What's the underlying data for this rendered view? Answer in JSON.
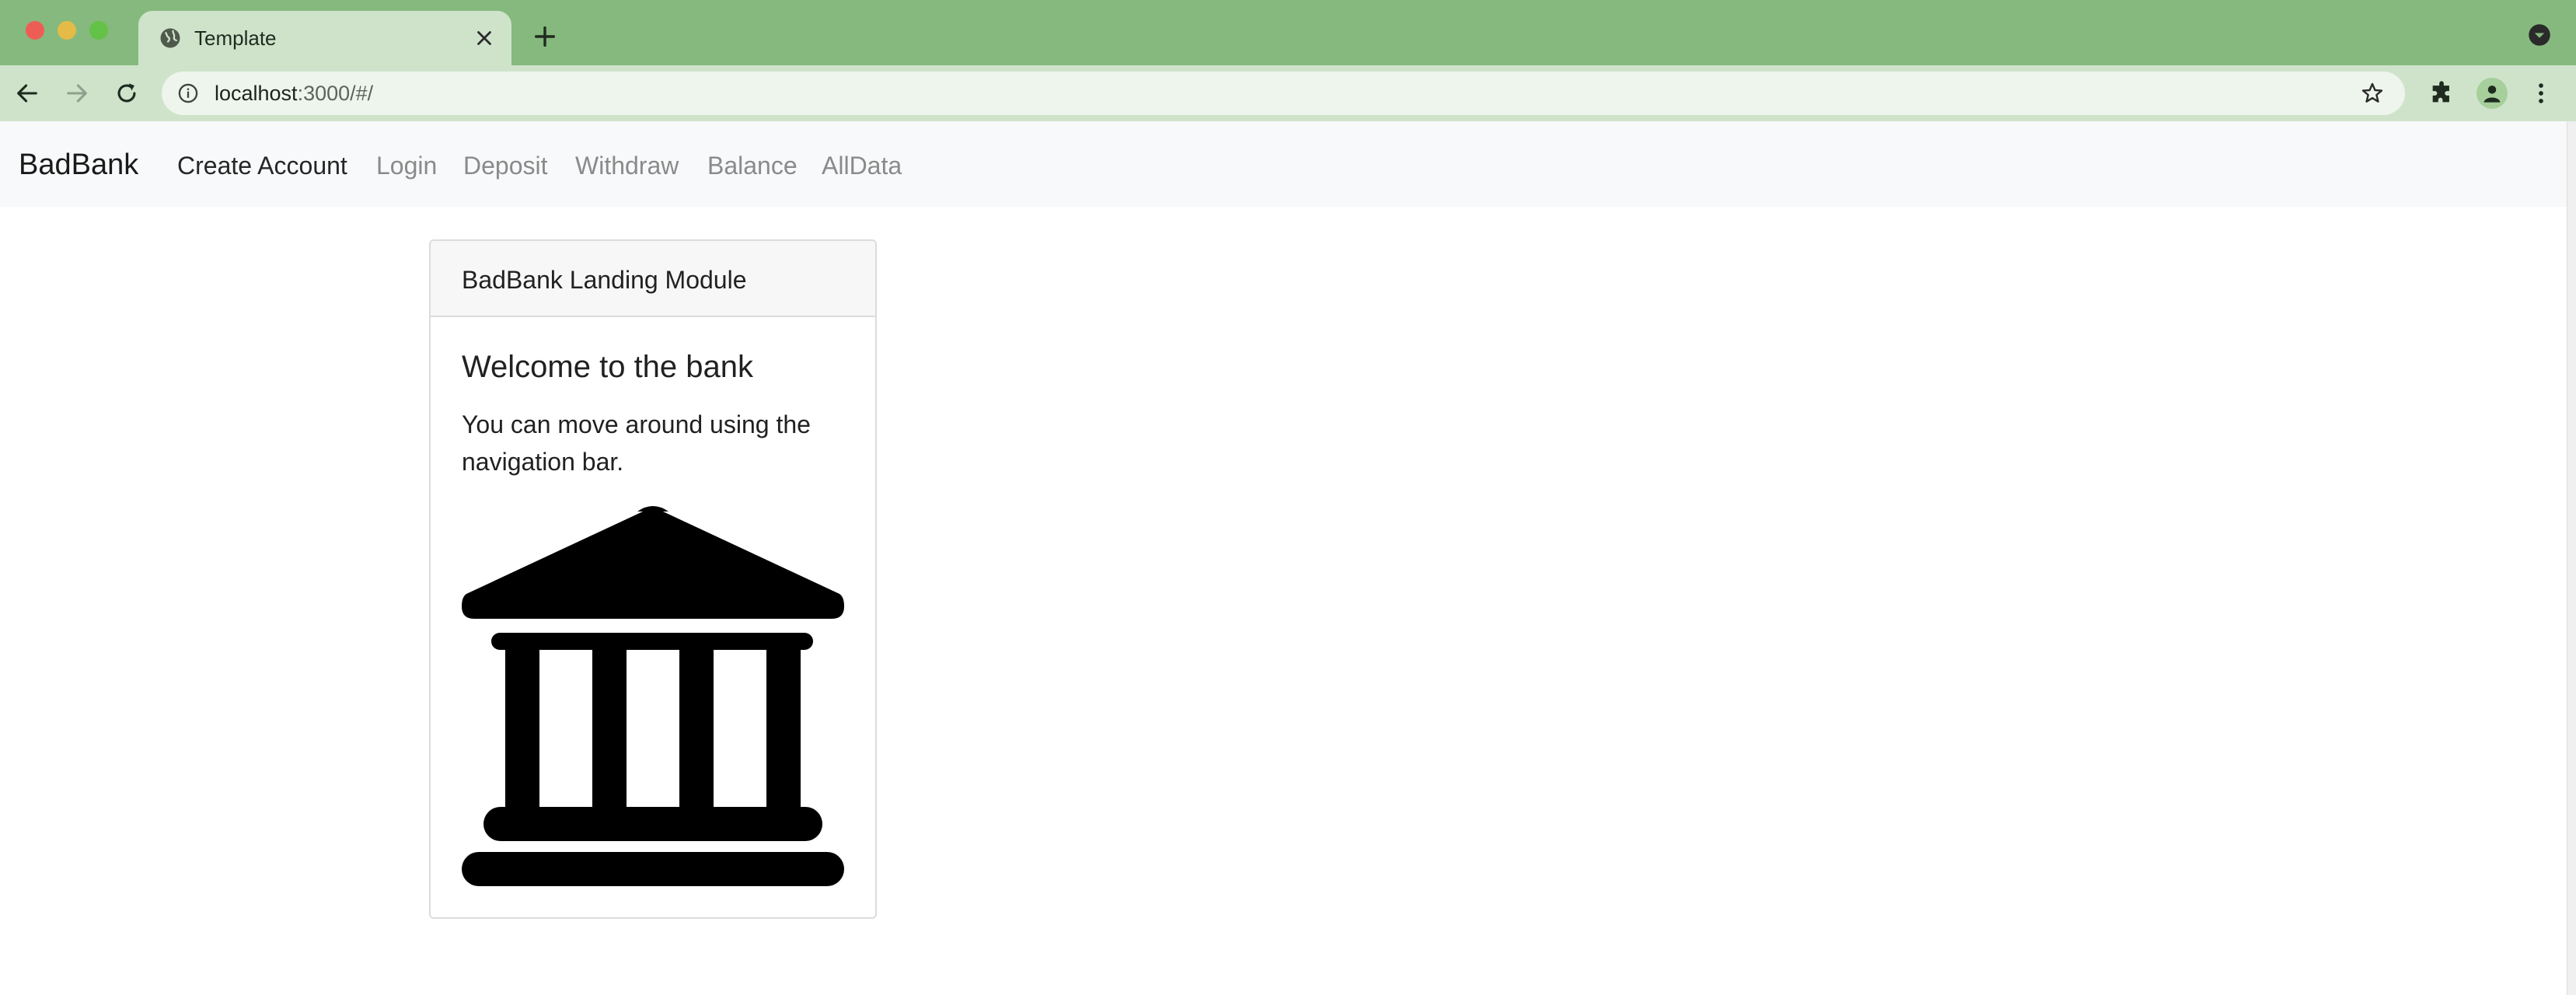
{
  "browser": {
    "tab_title": "Template",
    "url_host": "localhost",
    "url_path": ":3000/#/"
  },
  "navbar": {
    "brand": "BadBank",
    "items": [
      {
        "label": "Create Account",
        "active": true
      },
      {
        "label": "Login",
        "active": false
      },
      {
        "label": "Deposit",
        "active": false
      },
      {
        "label": "Withdraw",
        "active": false
      },
      {
        "label": "Balance",
        "active": false
      },
      {
        "label": "AllData",
        "active": false
      }
    ]
  },
  "card": {
    "header": "BadBank Landing Module",
    "title": "Welcome to the bank",
    "text": "You can move around using the navigation bar.",
    "image_icon": "bank-building-icon"
  },
  "colors": {
    "tabstrip": "#86b97e",
    "toolbar": "#cfe3cb",
    "navbar_bg": "#f8f9fa",
    "nav_inactive": "#8a8a8a",
    "nav_active": "#262626"
  }
}
